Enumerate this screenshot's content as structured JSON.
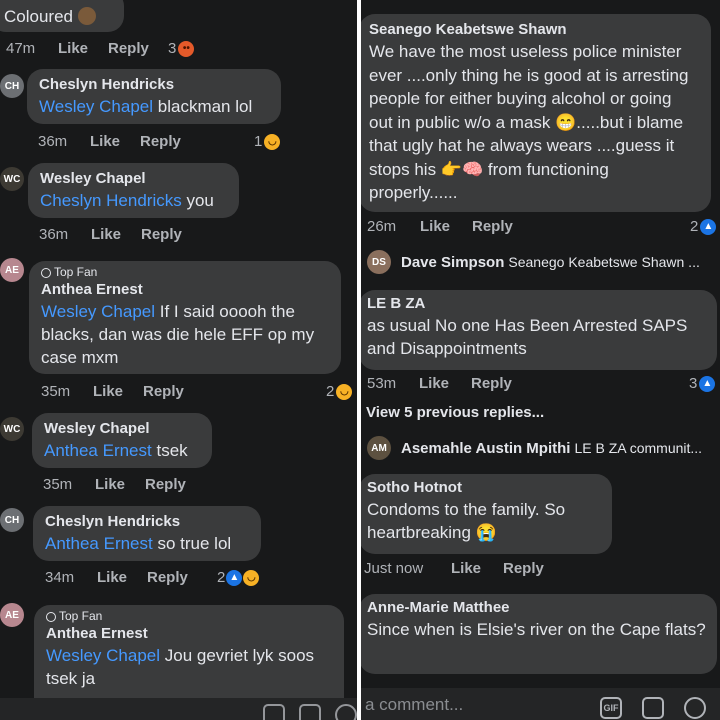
{
  "left": {
    "top_comment": {
      "text": "Coloured",
      "time": "47m",
      "like": "Like",
      "reply": "Reply",
      "reaction_count": "3"
    },
    "comments": [
      {
        "author": "Cheslyn Hendricks",
        "tag": "Wesley Chapel",
        "text": " blackman lol",
        "time": "36m",
        "like": "Like",
        "reply": "Reply",
        "reaction_count": "1"
      },
      {
        "author": "Wesley Chapel",
        "tag": "Cheslyn Hendricks",
        "text": " you",
        "time": "36m",
        "like": "Like",
        "reply": "Reply"
      },
      {
        "badge": "Top Fan",
        "author": "Anthea Ernest",
        "tag": "Wesley Chapel",
        "text": " If I said ooooh the blacks, dan was die hele EFF op my case mxm",
        "time": "35m",
        "like": "Like",
        "reply": "Reply",
        "reaction_count": "2"
      },
      {
        "author": "Wesley Chapel",
        "tag": "Anthea Ernest",
        "text": " tsek",
        "time": "35m",
        "like": "Like",
        "reply": "Reply"
      },
      {
        "author": "Cheslyn Hendricks",
        "tag": "Anthea Ernest",
        "text": " so true lol",
        "time": "34m",
        "like": "Like",
        "reply": "Reply",
        "reaction_count": "2"
      },
      {
        "badge": "Top Fan",
        "author": "Anthea Ernest",
        "tag": "Wesley Chapel",
        "text": " Jou gevriet lyk soos tsek ja"
      }
    ]
  },
  "right": {
    "comments": [
      {
        "author": "Seanego Keabetswe Shawn",
        "text": "We have the most useless police minister ever ....only thing he is good at is arresting people for either buying alcohol or going out in public w/o a mask 😁.....but  i blame that ugly hat he always wears ....guess it stops his 👉🧠 from functioning properly......",
        "time": "26m",
        "like": "Like",
        "reply": "Reply",
        "reaction_count": "2"
      },
      {
        "author": "LE B ZA",
        "text": "as usual No one Has Been Arrested SAPS and Disappointments",
        "time": "53m",
        "like": "Like",
        "reply": "Reply",
        "reaction_count": "3"
      },
      {
        "author": "Sotho Hotnot",
        "text": "Condoms to the family. So heartbreaking 😭",
        "time": "Just now",
        "like": "Like",
        "reply": "Reply"
      },
      {
        "author": "Anne-Marie Matthee",
        "text": "Since when is Elsie's river on the Cape flats?"
      }
    ],
    "reply_summary_1": {
      "author": "Dave Simpson",
      "snippet": "Seanego Keabetswe Shawn ..."
    },
    "view_previous": "View 5 previous replies...",
    "reply_summary_2": {
      "author": "Asemahle Austin Mpithi",
      "snippet": "LE B ZA communit..."
    },
    "composer_placeholder": "a comment...",
    "composer_icons": {
      "gif": "GIF"
    }
  }
}
